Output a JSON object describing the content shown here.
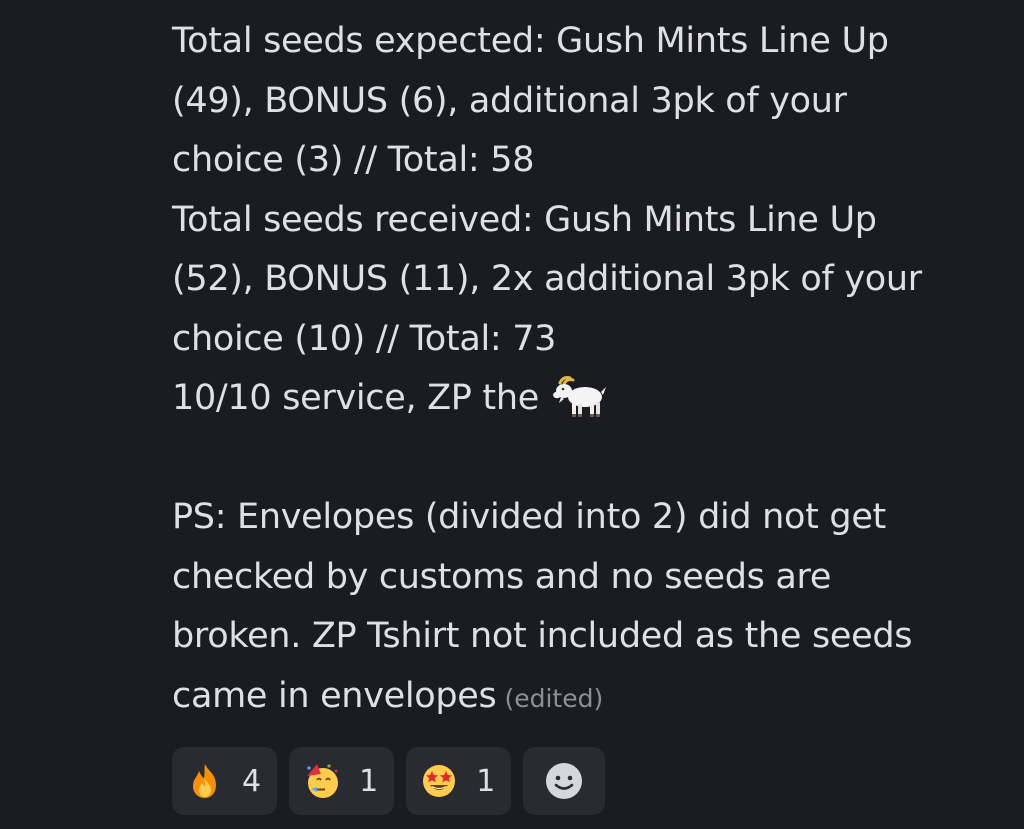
{
  "message": {
    "lines": [
      "Total seeds expected: Gush Mints Line Up",
      "(49), BONUS (6), additional 3pk of your",
      "choice (3) // Total: 58",
      "Total seeds received: Gush Mints Line Up",
      "(52), BONUS (11), 2x additional 3pk of your",
      "choice (10) // Total: 73",
      "10/10 service, ZP the"
    ],
    "ps_lines": [
      "PS: Envelopes (divided into 2) did not get",
      "checked by customs and no seeds are",
      "broken. ZP Tshirt not included as the seeds",
      "came in envelopes"
    ],
    "edited_label": "(edited)",
    "inline_emoji": "goat-icon"
  },
  "reactions": [
    {
      "icon": "fire-icon",
      "count": "4"
    },
    {
      "icon": "party-face-icon",
      "count": "1"
    },
    {
      "icon": "star-struck-icon",
      "count": "1"
    }
  ],
  "add_reaction_icon": "add-reaction-smiley-icon",
  "colors": {
    "background": "#1b1c1f",
    "text": "#dfe0e3",
    "muted": "#8c8f96",
    "pill": "#2a2b30"
  }
}
